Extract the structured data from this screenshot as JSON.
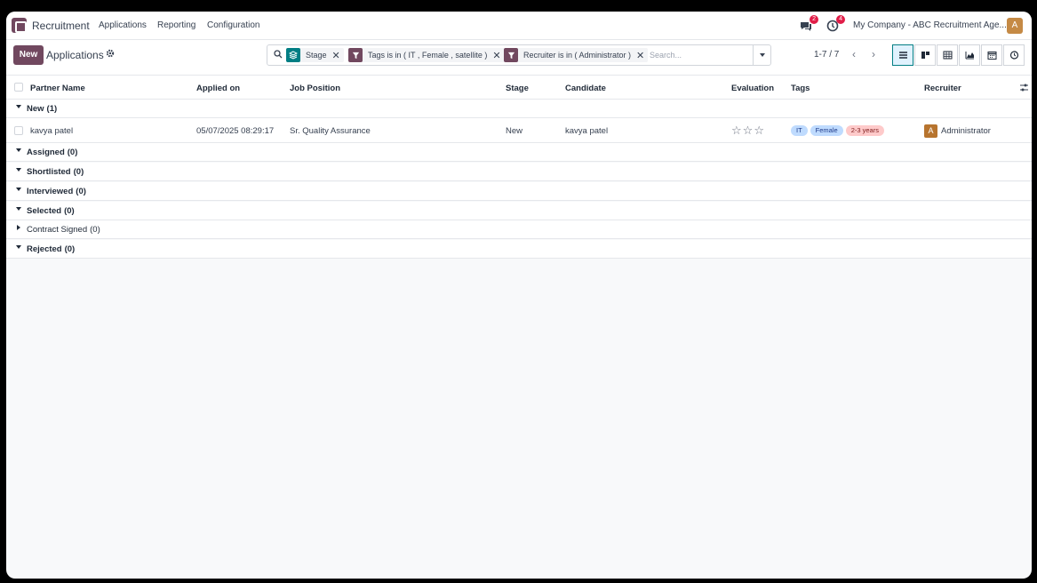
{
  "navbar": {
    "app_name": "Recruitment",
    "menu": [
      "Applications",
      "Reporting",
      "Configuration"
    ],
    "messages_count": "2",
    "activities_count": "4",
    "company": "My Company - ABC Recruitment Age...",
    "user_initial": "A"
  },
  "control": {
    "new_label": "New",
    "title": "Applications",
    "facets": [
      {
        "icon": "layers-icon",
        "label": "Stage",
        "color": "#017e84"
      },
      {
        "icon": "filter-icon",
        "label": "Tags is in ( IT , Female , satellite )",
        "color": "#71485f"
      },
      {
        "icon": "filter-icon",
        "label": "Recruiter is in ( Administrator )",
        "color": "#71485f"
      }
    ],
    "search_placeholder": "Search...",
    "pager": "1-7 / 7",
    "views": [
      "list",
      "kanban",
      "pivot",
      "graph",
      "calendar",
      "activity"
    ],
    "active_view": "list"
  },
  "table": {
    "columns": [
      "Partner Name",
      "Applied on",
      "Job Position",
      "Stage",
      "Candidate",
      "Evaluation",
      "Tags",
      "Recruiter"
    ],
    "groups": [
      {
        "label": "New",
        "count": "(1)",
        "expanded": true
      },
      {
        "label": "Assigned",
        "count": "(0)",
        "expanded": true
      },
      {
        "label": "Shortlisted",
        "count": "(0)",
        "expanded": true
      },
      {
        "label": "Interviewed",
        "count": "(0)",
        "expanded": true
      },
      {
        "label": "Selected",
        "count": "(0)",
        "expanded": true
      },
      {
        "label": "Contract Signed",
        "count": "(0)",
        "expanded": false
      },
      {
        "label": "Rejected",
        "count": "(0)",
        "expanded": true
      }
    ],
    "rows": [
      {
        "partner_name": "kavya patel",
        "applied_on": "05/07/2025 08:29:17",
        "job_position": "Sr. Quality Assurance",
        "stage": "New",
        "candidate": "kavya patel",
        "evaluation_stars": 0,
        "evaluation_max": 3,
        "tags": [
          {
            "label": "IT",
            "bg": "#bfdbfe",
            "fg": "#1e3a8a"
          },
          {
            "label": "Female",
            "bg": "#bfdbfe",
            "fg": "#1e3a8a"
          },
          {
            "label": "2-3 years",
            "bg": "#fecaca",
            "fg": "#7f1d1d"
          }
        ],
        "recruiter_initial": "A",
        "recruiter": "Administrator"
      }
    ]
  }
}
